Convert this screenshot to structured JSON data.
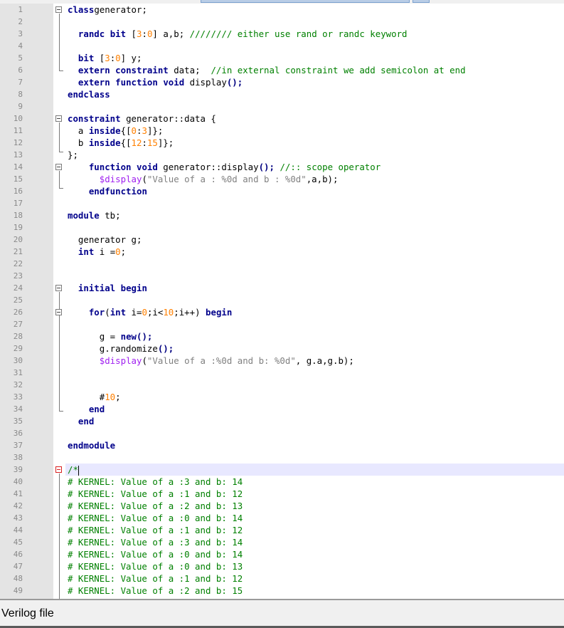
{
  "editor": {
    "language": "Verilog",
    "line_numbers": [
      "1",
      "2",
      "3",
      "4",
      "5",
      "6",
      "7",
      "8",
      "9",
      "10",
      "11",
      "12",
      "13",
      "14",
      "15",
      "16",
      "17",
      "18",
      "19",
      "20",
      "21",
      "22",
      "23",
      "24",
      "25",
      "26",
      "27",
      "28",
      "29",
      "30",
      "31",
      "32",
      "33",
      "34",
      "35",
      "36",
      "37",
      "38",
      "39",
      "40",
      "41",
      "42",
      "43",
      "44",
      "45",
      "46",
      "47",
      "48",
      "49"
    ],
    "current_line": 39,
    "lines": [
      [
        [
          "kw",
          "class"
        ],
        [
          "",
          "generator;"
        ]
      ],
      [],
      [
        [
          "",
          "  "
        ],
        [
          "kw",
          "randc"
        ],
        [
          "",
          " "
        ],
        [
          "kw",
          "bit"
        ],
        [
          "",
          " ["
        ],
        [
          "num",
          "3"
        ],
        [
          "",
          ":"
        ],
        [
          "num",
          "0"
        ],
        [
          "",
          "] a,b; "
        ],
        [
          "cm",
          "//////// either use rand or randc keyword"
        ]
      ],
      [],
      [
        [
          "",
          "  "
        ],
        [
          "kw",
          "bit"
        ],
        [
          "",
          " ["
        ],
        [
          "num",
          "3"
        ],
        [
          "",
          ":"
        ],
        [
          "num",
          "0"
        ],
        [
          "",
          "] y;"
        ]
      ],
      [
        [
          "",
          "  "
        ],
        [
          "kw",
          "extern"
        ],
        [
          "",
          " "
        ],
        [
          "kw",
          "constraint"
        ],
        [
          "",
          " data;  "
        ],
        [
          "cm",
          "//in external constraint we add semicolon at end"
        ]
      ],
      [
        [
          "",
          "  "
        ],
        [
          "kw",
          "extern"
        ],
        [
          "",
          " "
        ],
        [
          "kw",
          "function"
        ],
        [
          "",
          " "
        ],
        [
          "kw",
          "void"
        ],
        [
          "",
          " display"
        ],
        [
          "op",
          "();"
        ]
      ],
      [
        [
          "kw",
          "endclass"
        ]
      ],
      [],
      [
        [
          "kw",
          "constraint"
        ],
        [
          "",
          " generator::data {"
        ]
      ],
      [
        [
          "",
          "  a "
        ],
        [
          "kw",
          "inside"
        ],
        [
          "",
          "{["
        ],
        [
          "num",
          "0"
        ],
        [
          "",
          ":"
        ],
        [
          "num",
          "3"
        ],
        [
          "",
          "]};"
        ]
      ],
      [
        [
          "",
          "  b "
        ],
        [
          "kw",
          "inside"
        ],
        [
          "",
          "{["
        ],
        [
          "num",
          "12"
        ],
        [
          "",
          ":"
        ],
        [
          "num",
          "15"
        ],
        [
          "",
          "]};"
        ]
      ],
      [
        [
          "",
          "};"
        ]
      ],
      [
        [
          "",
          "    "
        ],
        [
          "kw",
          "function"
        ],
        [
          "",
          " "
        ],
        [
          "kw",
          "void"
        ],
        [
          "",
          " generator::display"
        ],
        [
          "op",
          "();"
        ],
        [
          "",
          " "
        ],
        [
          "cm",
          "//:: scope operator"
        ]
      ],
      [
        [
          "",
          "      "
        ],
        [
          "sys",
          "$display"
        ],
        [
          "",
          "("
        ],
        [
          "str",
          "\"Value of a : %0d and b : %0d\""
        ],
        [
          "",
          ",a,b);"
        ]
      ],
      [
        [
          "",
          "    "
        ],
        [
          "kw",
          "endfunction"
        ]
      ],
      [],
      [
        [
          "kw",
          "module"
        ],
        [
          "",
          " tb;"
        ]
      ],
      [],
      [
        [
          "",
          "  generator g;"
        ]
      ],
      [
        [
          "",
          "  "
        ],
        [
          "kw",
          "int"
        ],
        [
          "",
          " i ="
        ],
        [
          "num",
          "0"
        ],
        [
          "",
          ";"
        ]
      ],
      [],
      [],
      [
        [
          "",
          "  "
        ],
        [
          "kw",
          "initial"
        ],
        [
          "",
          " "
        ],
        [
          "kw",
          "begin"
        ]
      ],
      [],
      [
        [
          "",
          "    "
        ],
        [
          "kw",
          "for"
        ],
        [
          "",
          "("
        ],
        [
          "kw",
          "int"
        ],
        [
          "",
          " i="
        ],
        [
          "num",
          "0"
        ],
        [
          "",
          ";i<"
        ],
        [
          "num",
          "10"
        ],
        [
          "",
          ";i++) "
        ],
        [
          "kw",
          "begin"
        ]
      ],
      [],
      [
        [
          "",
          "      g = "
        ],
        [
          "kw",
          "new"
        ],
        [
          "op",
          "();"
        ]
      ],
      [
        [
          "",
          "      g.randomize"
        ],
        [
          "op",
          "();"
        ]
      ],
      [
        [
          "",
          "      "
        ],
        [
          "sys",
          "$display"
        ],
        [
          "",
          "("
        ],
        [
          "str",
          "\"Value of a :%0d and b: %0d\""
        ],
        [
          "",
          ", g.a,g.b);"
        ]
      ],
      [],
      [],
      [
        [
          "",
          "      #"
        ],
        [
          "num",
          "10"
        ],
        [
          "",
          ";"
        ]
      ],
      [
        [
          "",
          "    "
        ],
        [
          "kw",
          "end"
        ]
      ],
      [
        [
          "",
          "  "
        ],
        [
          "kw",
          "end"
        ]
      ],
      [],
      [
        [
          "kw",
          "endmodule"
        ]
      ],
      [],
      [
        [
          "cm",
          "/*"
        ]
      ],
      [
        [
          "cm",
          "# KERNEL: Value of a :3 and b: 14"
        ]
      ],
      [
        [
          "cm",
          "# KERNEL: Value of a :1 and b: 12"
        ]
      ],
      [
        [
          "cm",
          "# KERNEL: Value of a :2 and b: 13"
        ]
      ],
      [
        [
          "cm",
          "# KERNEL: Value of a :0 and b: 14"
        ]
      ],
      [
        [
          "cm",
          "# KERNEL: Value of a :1 and b: 12"
        ]
      ],
      [
        [
          "cm",
          "# KERNEL: Value of a :3 and b: 14"
        ]
      ],
      [
        [
          "cm",
          "# KERNEL: Value of a :0 and b: 14"
        ]
      ],
      [
        [
          "cm",
          "# KERNEL: Value of a :0 and b: 13"
        ]
      ],
      [
        [
          "cm",
          "# KERNEL: Value of a :1 and b: 12"
        ]
      ],
      [
        [
          "cm",
          "# KERNEL: Value of a :2 and b: 15"
        ]
      ]
    ]
  },
  "status_bar": {
    "file_type": "Verilog file"
  },
  "colors": {
    "keyword": "#00008b",
    "number": "#ff8000",
    "comment": "#008000",
    "system_task": "#a020f0",
    "string": "#808080",
    "current_line_bg": "#e8e8ff"
  }
}
